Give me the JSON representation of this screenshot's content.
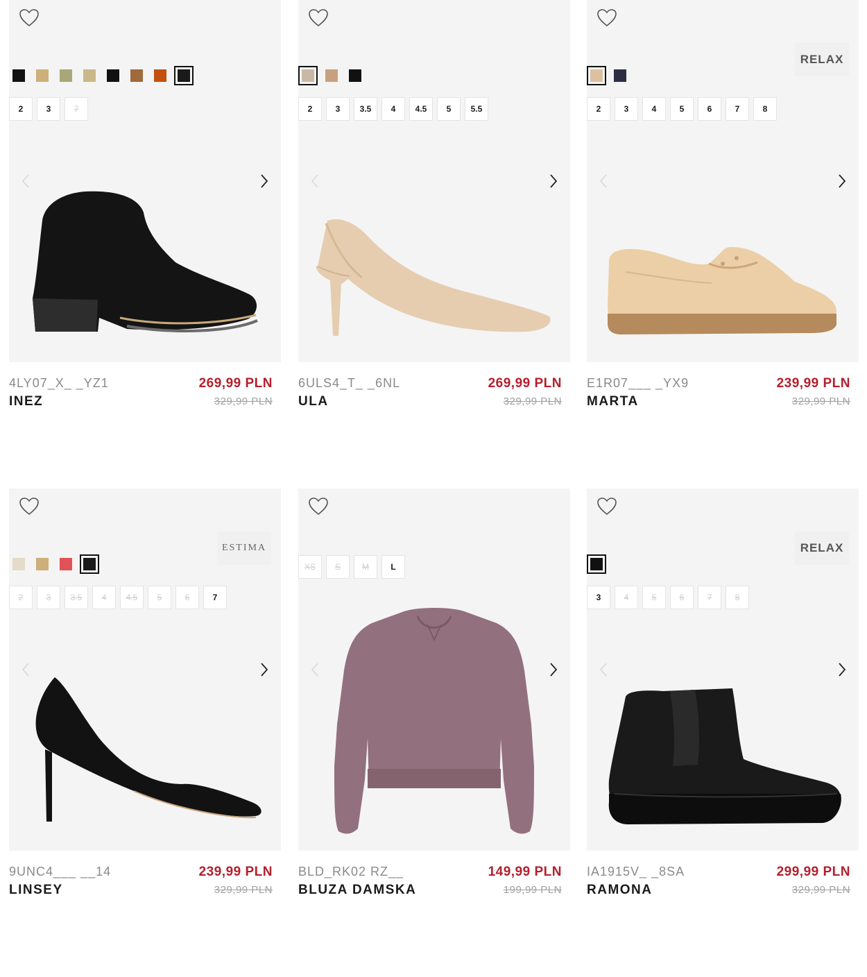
{
  "products": [
    {
      "sku": "4LY07_X_ _YZ1",
      "name": "INEZ",
      "price": "269,99 PLN",
      "old_price": "329,99 PLN",
      "brand_badge": "",
      "swatches": [
        "#111111",
        "#cdb07a",
        "#a8a778",
        "#cbb888",
        "#111111",
        "#a06a3a",
        "#c4500e",
        "#1a1a1a"
      ],
      "active_swatch": 7,
      "sizes": [
        {
          "label": "2",
          "available": true
        },
        {
          "label": "3",
          "available": true
        },
        {
          "label": "7",
          "available": false
        }
      ]
    },
    {
      "sku": "6ULS4_T_ _6NL",
      "name": "ULA",
      "price": "269,99 PLN",
      "old_price": "329,99 PLN",
      "brand_badge": "",
      "swatches": [
        "#c9b9a4",
        "#c8a07e",
        "#111111"
      ],
      "active_swatch": 0,
      "sizes": [
        {
          "label": "2",
          "available": true
        },
        {
          "label": "3",
          "available": true
        },
        {
          "label": "3.5",
          "available": true
        },
        {
          "label": "4",
          "available": true
        },
        {
          "label": "4.5",
          "available": true
        },
        {
          "label": "5",
          "available": true
        },
        {
          "label": "5.5",
          "available": true
        }
      ]
    },
    {
      "sku": "E1R07___ _YX9",
      "name": "MARTA",
      "price": "239,99 PLN",
      "old_price": "329,99 PLN",
      "brand_badge": "RELAX",
      "swatches": [
        "#dcc0a0",
        "#2b2f44"
      ],
      "active_swatch": 0,
      "sizes": [
        {
          "label": "2",
          "available": true
        },
        {
          "label": "3",
          "available": true
        },
        {
          "label": "4",
          "available": true
        },
        {
          "label": "5",
          "available": true
        },
        {
          "label": "6",
          "available": true
        },
        {
          "label": "7",
          "available": true
        },
        {
          "label": "8",
          "available": true
        }
      ]
    },
    {
      "sku": "9UNC4___ __14",
      "name": "LINSEY",
      "price": "239,99 PLN",
      "old_price": "329,99 PLN",
      "brand_badge": "ESTIMA",
      "swatches": [
        "#e4dcc8",
        "#cdb07a",
        "#e05258",
        "#1a1a1a"
      ],
      "active_swatch": 3,
      "sizes": [
        {
          "label": "2",
          "available": false
        },
        {
          "label": "3",
          "available": false
        },
        {
          "label": "3.5",
          "available": false
        },
        {
          "label": "4",
          "available": false
        },
        {
          "label": "4.5",
          "available": false
        },
        {
          "label": "5",
          "available": false
        },
        {
          "label": "6",
          "available": false
        },
        {
          "label": "7",
          "available": true
        }
      ]
    },
    {
      "sku": "BLD_RK02 RZ__",
      "name": "BLUZA DAMSKA",
      "price": "149,99 PLN",
      "old_price": "199,99 PLN",
      "brand_badge": "",
      "swatches": [],
      "active_swatch": -1,
      "sizes": [
        {
          "label": "XS",
          "available": false
        },
        {
          "label": "S",
          "available": false
        },
        {
          "label": "M",
          "available": false
        },
        {
          "label": "L",
          "available": true
        }
      ]
    },
    {
      "sku": "IA1915V_ _8SA",
      "name": "RAMONA",
      "price": "299,99 PLN",
      "old_price": "329,99 PLN",
      "brand_badge": "RELAX",
      "swatches": [
        "#111111"
      ],
      "active_swatch": 0,
      "sizes": [
        {
          "label": "3",
          "available": true
        },
        {
          "label": "4",
          "available": false
        },
        {
          "label": "5",
          "available": false
        },
        {
          "label": "6",
          "available": false
        },
        {
          "label": "7",
          "available": false
        },
        {
          "label": "8",
          "available": false
        }
      ]
    }
  ]
}
